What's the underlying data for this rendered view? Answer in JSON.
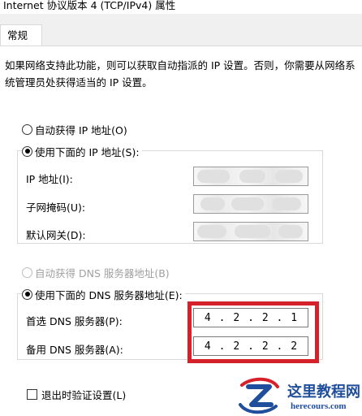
{
  "window": {
    "title": "Internet 协议版本 4 (TCP/IPv4) 属性"
  },
  "tabs": [
    {
      "label": "常规",
      "active": true
    }
  ],
  "description": "如果网络支持此功能，则可以获取自动指派的 IP 设置。否则，你需要从网络系统管理员处获得适当的 IP 设置。",
  "ip_section": {
    "auto_label": "自动获得 IP 地址(O)",
    "auto_checked": false,
    "manual_label": "使用下面的 IP 地址(S):",
    "manual_checked": true,
    "fields": [
      {
        "label": "IP 地址(I):",
        "value_obscured": true
      },
      {
        "label": "子网掩码(U):",
        "value_obscured": true
      },
      {
        "label": "默认网关(D):",
        "value_obscured": true
      }
    ]
  },
  "dns_section": {
    "auto_label": "自动获得 DNS 服务器地址(B)",
    "auto_checked": false,
    "auto_disabled": true,
    "manual_label": "使用下面的 DNS 服务器地址(E):",
    "manual_checked": true,
    "preferred": {
      "label": "首选 DNS 服务器(P):",
      "octets": [
        "4",
        "2",
        "2",
        "1"
      ]
    },
    "alternate": {
      "label": "备用 DNS 服务器(A):",
      "octets": [
        "4",
        "2",
        "2",
        "2"
      ]
    },
    "dot": "."
  },
  "validate": {
    "label": "退出时验证设置(L)",
    "checked": false
  },
  "watermark": {
    "name": "这里教程网",
    "url": "herecours.com"
  },
  "colors": {
    "highlight": "#d6202a",
    "watermark_blue": "#1f4e9c",
    "tab_strip_bg": "#f0f0f0",
    "border": "#d9d9d9"
  },
  "icons": {
    "watermark_logo": "z-logo-icon"
  }
}
